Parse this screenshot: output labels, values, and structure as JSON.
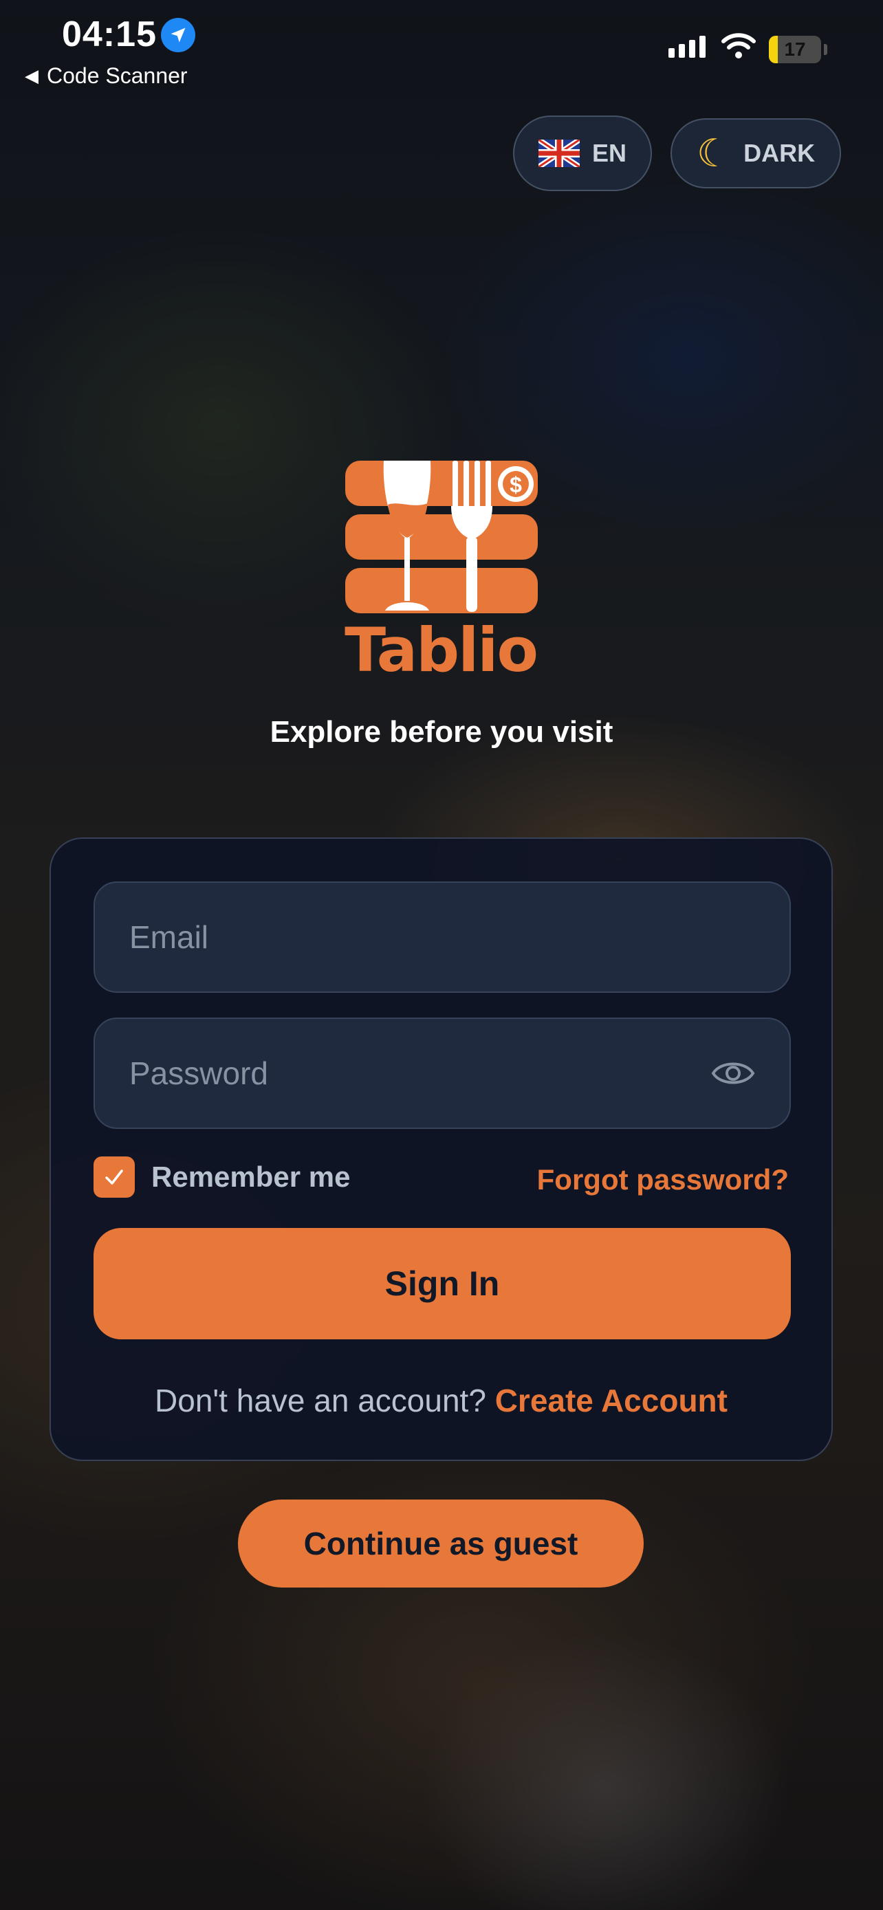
{
  "status_bar": {
    "time": "04:15",
    "back_app": "Code Scanner",
    "battery": 17,
    "battery_label": "17"
  },
  "top_controls": {
    "language_label": "EN",
    "theme_label": "DARK",
    "flag_icon": "uk-flag-icon",
    "theme_icon": "moon-icon"
  },
  "brand": {
    "name": "Tablio",
    "tagline": "Explore before you visit",
    "logo_icon": "wine-glass-fork-logo",
    "color": "#e8773a"
  },
  "login_form": {
    "email_placeholder": "Email",
    "password_placeholder": "Password",
    "remember_label": "Remember me",
    "remember_checked": true,
    "forgot_label": "Forgot password?",
    "signin_label": "Sign In",
    "no_account_text": "Don't have an account?",
    "create_account_label": "Create Account"
  },
  "guest_label": "Continue as guest",
  "colors": {
    "accent": "#e8773a",
    "card_bg": "#0e1426",
    "field_bg": "#1f2a3e"
  }
}
